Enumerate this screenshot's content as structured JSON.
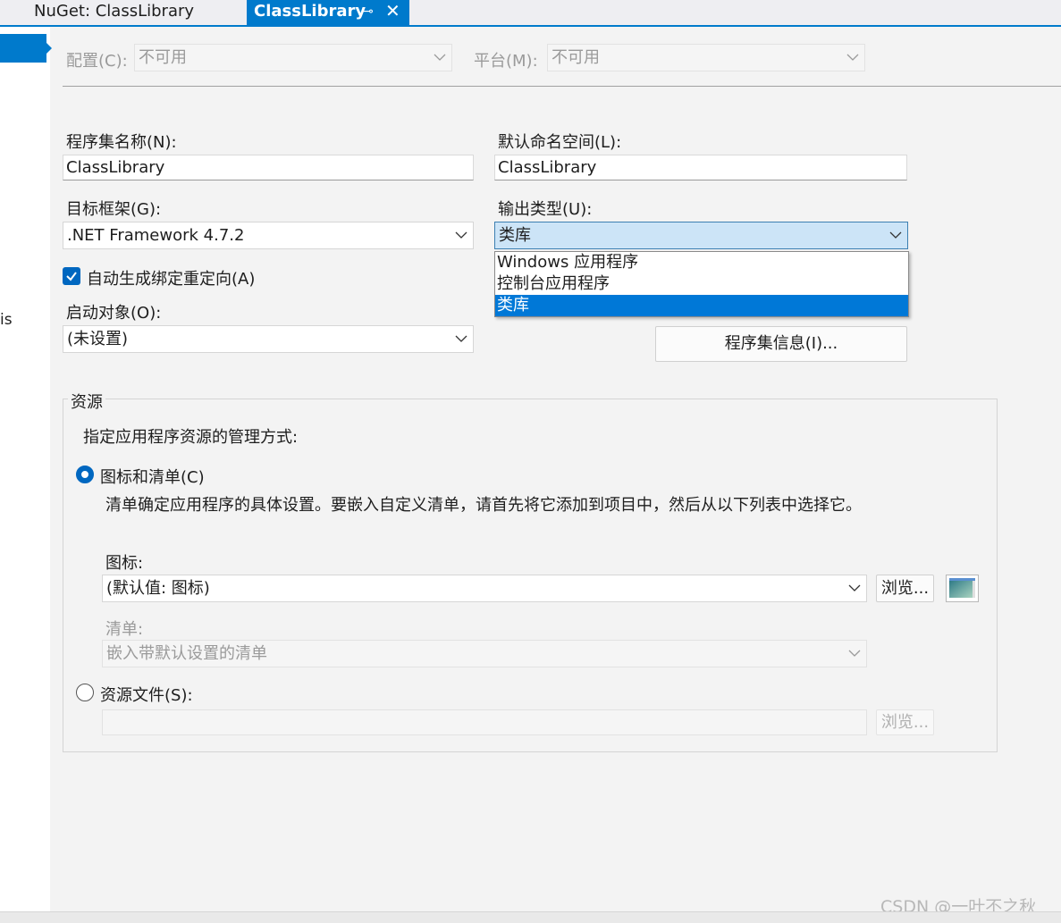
{
  "tabs": [
    {
      "label": "NuGet: ClassLibrary",
      "active": false
    },
    {
      "label": "ClassLibrary",
      "active": true,
      "pin_glyph": "⊸",
      "close_glyph": "✕"
    }
  ],
  "left_nav": {
    "cut_off_text": "is"
  },
  "config": {
    "configuration_label": "配置(C):",
    "configuration_value": "不可用",
    "platform_label": "平台(M):",
    "platform_value": "不可用"
  },
  "application": {
    "assembly_name_label": "程序集名称(N):",
    "assembly_name_value": "ClassLibrary",
    "default_namespace_label": "默认命名空间(L):",
    "default_namespace_value": "ClassLibrary",
    "target_framework_label": "目标框架(G):",
    "target_framework_value": ".NET Framework 4.7.2",
    "output_type_label": "输出类型(U):",
    "output_type_value": "类库",
    "output_type_options": [
      "Windows 应用程序",
      "控制台应用程序",
      "类库"
    ],
    "auto_binding_label": "自动生成绑定重定向(A)",
    "auto_binding_checked": true,
    "startup_object_label": "启动对象(O):",
    "startup_object_value": "(未设置)",
    "assembly_info_button": "程序集信息(I)..."
  },
  "resources": {
    "group_title": "资源",
    "description": "指定应用程序资源的管理方式:",
    "icon_manifest_radio_label": "图标和清单(C)",
    "icon_manifest_selected": true,
    "icon_manifest_help": "清单确定应用程序的具体设置。要嵌入自定义清单，请首先将它添加到项目中，然后从以下列表中选择它。",
    "icon_label": "图标:",
    "icon_value": "(默认值: 图标)",
    "browse_label": "浏览...",
    "manifest_label": "清单:",
    "manifest_value": "嵌入带默认设置的清单",
    "resource_file_radio_label": "资源文件(S):",
    "resource_file_value": "",
    "resource_browse_label": "浏览..."
  },
  "watermark": "CSDN @一叶不之秋",
  "colors": {
    "accent": "#007acc",
    "selection": "#0078d7",
    "checkbox": "#0067c0",
    "background": "#f3f3f3"
  }
}
